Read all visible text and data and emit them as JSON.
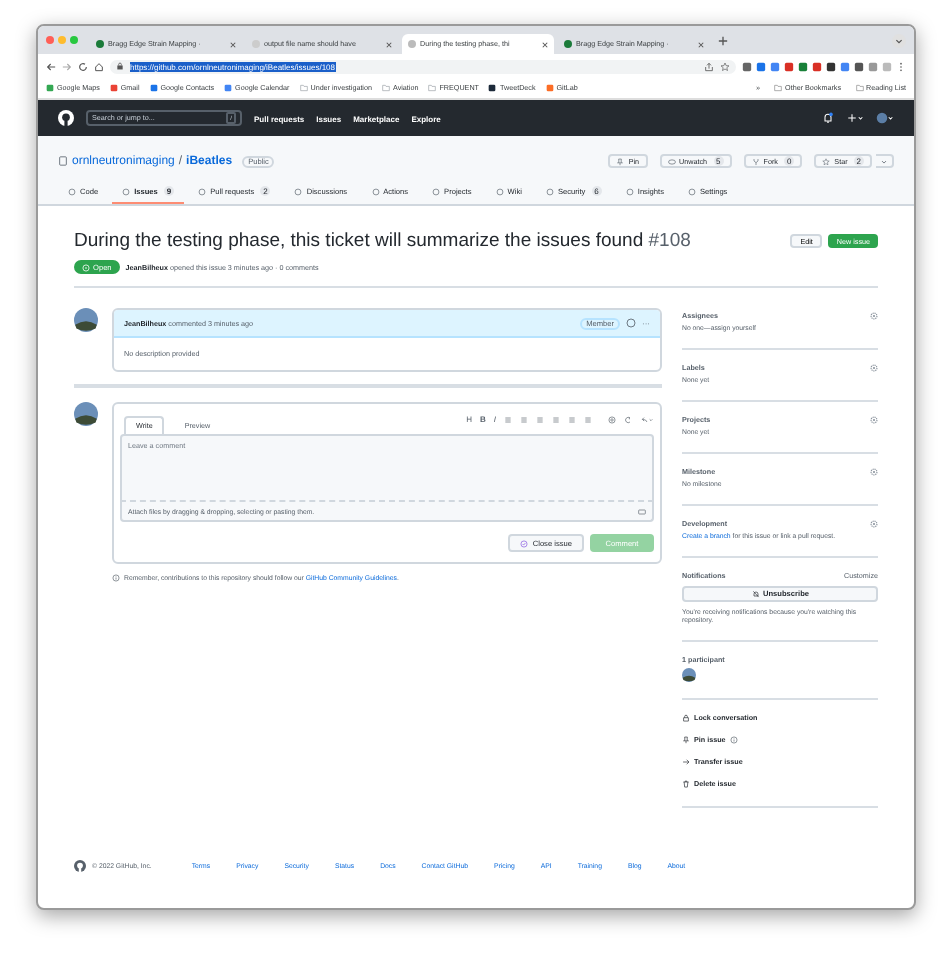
{
  "browser": {
    "tabs": [
      {
        "title": "Bragg Edge Strain Mapping ·",
        "selected": false
      },
      {
        "title": "output file name should have",
        "selected": false
      },
      {
        "title": "During the testing phase, thi",
        "selected": true
      },
      {
        "title": "Bragg Edge Strain Mapping ·",
        "selected": false
      }
    ],
    "url": "https://github.com/ornlneutronimaging/iBeatles/issues/108",
    "bookmarks": [
      {
        "kind": "map",
        "label": "Google Maps"
      },
      {
        "kind": "mail",
        "label": "Gmail"
      },
      {
        "kind": "contacts",
        "label": "Google Contacts"
      },
      {
        "kind": "calendar",
        "label": "Google Calendar"
      },
      {
        "kind": "folder",
        "label": "Under investigation"
      },
      {
        "kind": "folder",
        "label": "Aviation"
      },
      {
        "kind": "folder",
        "label": "FREQUENT"
      },
      {
        "kind": "deck",
        "label": "TweetDeck"
      },
      {
        "kind": "gitlab",
        "label": "GitLab"
      }
    ],
    "overflow": "»",
    "bookmarks_right": [
      "Other Bookmarks",
      "Reading List"
    ]
  },
  "header": {
    "search_placeholder": "Search or jump to...",
    "slash_key": "/",
    "nav": [
      "Pull requests",
      "Issues",
      "Marketplace",
      "Explore"
    ]
  },
  "repo": {
    "owner": "ornlneutronimaging",
    "separator": "/",
    "name": "iBeatles",
    "visibility": "Public",
    "actions": [
      {
        "kind": "pin",
        "label": "Pin"
      },
      {
        "kind": "watch",
        "label": "Unwatch",
        "count": "5"
      },
      {
        "kind": "fork",
        "label": "Fork",
        "count": "0"
      },
      {
        "kind": "star",
        "label": "Star",
        "count": "2"
      }
    ],
    "tabs": [
      {
        "label": "Code",
        "selected": false
      },
      {
        "label": "Issues",
        "count": "9",
        "selected": true
      },
      {
        "label": "Pull requests",
        "count": "2",
        "selected": false
      },
      {
        "label": "Discussions",
        "selected": false
      },
      {
        "label": "Actions",
        "selected": false
      },
      {
        "label": "Projects",
        "selected": false
      },
      {
        "label": "Wiki",
        "selected": false
      },
      {
        "label": "Security",
        "count": "6",
        "selected": false
      },
      {
        "label": "Insights",
        "selected": false
      },
      {
        "label": "Settings",
        "selected": false
      }
    ]
  },
  "issue": {
    "title": "During the testing phase, this ticket will summarize the issues found",
    "number": "#108",
    "edit": "Edit",
    "new_issue": "New issue",
    "state": "Open",
    "author": "JeanBilheux",
    "meta": "opened this issue 3 minutes ago · 0 comments"
  },
  "comment": {
    "author": "JeanBilheux",
    "time": "commented 3 minutes ago",
    "role": "Member",
    "more": "···",
    "body": "No description provided"
  },
  "composer": {
    "tabs": [
      {
        "label": "Write",
        "selected": true
      },
      {
        "label": "Preview",
        "selected": false
      }
    ],
    "toolbar": [
      "H",
      "B",
      "I"
    ],
    "placeholder": "Leave a comment",
    "attach": "Attach files by dragging & dropping, selecting or pasting them.",
    "close_button": "Close issue",
    "comment_button": {
      "label": "Comment",
      "disabled": true
    }
  },
  "note": {
    "text": "Remember, contributions to this repository should follow our",
    "link": "GitHub Community Guidelines",
    "end": "."
  },
  "sidebar": {
    "sections": [
      {
        "heading": "Assignees",
        "value": "No one—assign yourself"
      },
      {
        "heading": "Labels",
        "value": "None yet"
      },
      {
        "heading": "Projects",
        "value": "None yet"
      },
      {
        "heading": "Milestone",
        "value": "No milestone"
      },
      {
        "heading": "Development",
        "link": "Create a branch",
        "value": "for this issue or link a pull request."
      }
    ],
    "notifications": {
      "heading": "Notifications",
      "customize": "Customize",
      "button": "Unsubscribe",
      "reason": "You're receiving notifications because you're watching this repository."
    },
    "participants": "1 participant",
    "actions": [
      {
        "kind": "lock",
        "label": "Lock conversation"
      },
      {
        "kind": "pin",
        "label": "Pin issue"
      },
      {
        "kind": "transfer",
        "label": "Transfer issue"
      },
      {
        "kind": "delete",
        "label": "Delete issue"
      }
    ]
  },
  "footer": {
    "copyright": "© 2022 GitHub, Inc.",
    "links": [
      "Terms",
      "Privacy",
      "Security",
      "Status",
      "Docs",
      "Contact GitHub",
      "Pricing",
      "API",
      "Training",
      "Blog",
      "About"
    ]
  }
}
